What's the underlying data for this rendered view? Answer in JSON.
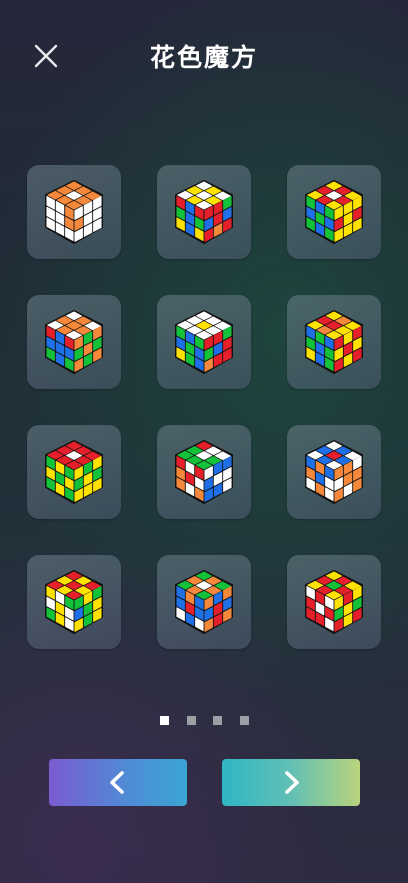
{
  "header": {
    "title": "花色魔方",
    "close_icon": "close-icon"
  },
  "patterns": [
    {
      "top": [
        "o",
        "o",
        "o",
        "o",
        "w",
        "o",
        "o",
        "o",
        "o"
      ],
      "left": [
        "w",
        "w",
        "o",
        "w",
        "w",
        "o",
        "w",
        "w",
        "w"
      ],
      "right": [
        "w",
        "w",
        "w",
        "o",
        "w",
        "w",
        "w",
        "w",
        "w"
      ]
    },
    {
      "top": [
        "w",
        "y",
        "w",
        "y",
        "w",
        "y",
        "w",
        "y",
        "w"
      ],
      "left": [
        "r",
        "b",
        "r",
        "g",
        "b",
        "g",
        "y",
        "b",
        "y"
      ],
      "right": [
        "r",
        "r",
        "g",
        "b",
        "r",
        "b",
        "r",
        "o",
        "r"
      ]
    },
    {
      "top": [
        "y",
        "r",
        "y",
        "r",
        "w",
        "r",
        "y",
        "r",
        "y"
      ],
      "left": [
        "g",
        "b",
        "g",
        "b",
        "g",
        "b",
        "g",
        "b",
        "g"
      ],
      "right": [
        "y",
        "y",
        "y",
        "r",
        "y",
        "r",
        "y",
        "y",
        "y"
      ]
    },
    {
      "top": [
        "w",
        "o",
        "w",
        "o",
        "o",
        "o",
        "w",
        "o",
        "w"
      ],
      "left": [
        "r",
        "b",
        "r",
        "b",
        "b",
        "b",
        "g",
        "b",
        "g"
      ],
      "right": [
        "o",
        "g",
        "o",
        "g",
        "o",
        "g",
        "o",
        "g",
        "o"
      ]
    },
    {
      "top": [
        "w",
        "w",
        "w",
        "w",
        "y",
        "w",
        "w",
        "w",
        "w"
      ],
      "left": [
        "g",
        "b",
        "g",
        "b",
        "g",
        "b",
        "y",
        "g",
        "b"
      ],
      "right": [
        "r",
        "r",
        "g",
        "g",
        "b",
        "r",
        "o",
        "r",
        "r"
      ]
    },
    {
      "top": [
        "y",
        "r",
        "y",
        "o",
        "r",
        "o",
        "y",
        "y",
        "y"
      ],
      "left": [
        "b",
        "g",
        "b",
        "g",
        "b",
        "g",
        "y",
        "b",
        "g"
      ],
      "right": [
        "r",
        "y",
        "r",
        "y",
        "r",
        "y",
        "r",
        "y",
        "r"
      ]
    },
    {
      "top": [
        "r",
        "r",
        "r",
        "r",
        "w",
        "r",
        "r",
        "r",
        "r"
      ],
      "left": [
        "g",
        "y",
        "g",
        "y",
        "g",
        "y",
        "g",
        "y",
        "g"
      ],
      "right": [
        "y",
        "g",
        "y",
        "g",
        "y",
        "g",
        "y",
        "y",
        "y"
      ]
    },
    {
      "top": [
        "g",
        "g",
        "r",
        "g",
        "w",
        "w",
        "g",
        "g",
        "w"
      ],
      "left": [
        "r",
        "w",
        "r",
        "o",
        "r",
        "w",
        "o",
        "w",
        "o"
      ],
      "right": [
        "w",
        "b",
        "b",
        "b",
        "w",
        "w",
        "b",
        "b",
        "w"
      ]
    },
    {
      "top": [
        "w",
        "b",
        "w",
        "b",
        "r",
        "b",
        "w",
        "b",
        "w"
      ],
      "left": [
        "b",
        "o",
        "b",
        "o",
        "b",
        "w",
        "w",
        "o",
        "w"
      ],
      "right": [
        "o",
        "o",
        "w",
        "w",
        "o",
        "o",
        "o",
        "w",
        "o"
      ]
    },
    {
      "top": [
        "r",
        "y",
        "r",
        "y",
        "r",
        "y",
        "r",
        "y",
        "r"
      ],
      "left": [
        "y",
        "w",
        "g",
        "w",
        "y",
        "w",
        "g",
        "y",
        "w"
      ],
      "right": [
        "g",
        "y",
        "g",
        "b",
        "g",
        "y",
        "y",
        "g",
        "y"
      ]
    },
    {
      "top": [
        "g",
        "o",
        "g",
        "o",
        "w",
        "o",
        "g",
        "o",
        "g"
      ],
      "left": [
        "b",
        "o",
        "b",
        "b",
        "r",
        "b",
        "w",
        "b",
        "w"
      ],
      "right": [
        "o",
        "b",
        "o",
        "b",
        "r",
        "b",
        "o",
        "r",
        "o"
      ]
    },
    {
      "top": [
        "y",
        "r",
        "y",
        "r",
        "g",
        "r",
        "y",
        "r",
        "y"
      ],
      "left": [
        "w",
        "r",
        "w",
        "r",
        "w",
        "r",
        "r",
        "r",
        "w"
      ],
      "right": [
        "y",
        "r",
        "y",
        "g",
        "y",
        "g",
        "r",
        "y",
        "r"
      ]
    }
  ],
  "pager": {
    "count": 4,
    "active": 0
  },
  "nav": {
    "prev_icon": "chevron-left-icon",
    "next_icon": "chevron-right-icon"
  },
  "colors": {
    "w": "#ffffff",
    "o": "#f5883a",
    "r": "#e5202a",
    "y": "#ffe200",
    "g": "#14c23a",
    "b": "#1f6fe6",
    "sticker_body": "#111111"
  }
}
